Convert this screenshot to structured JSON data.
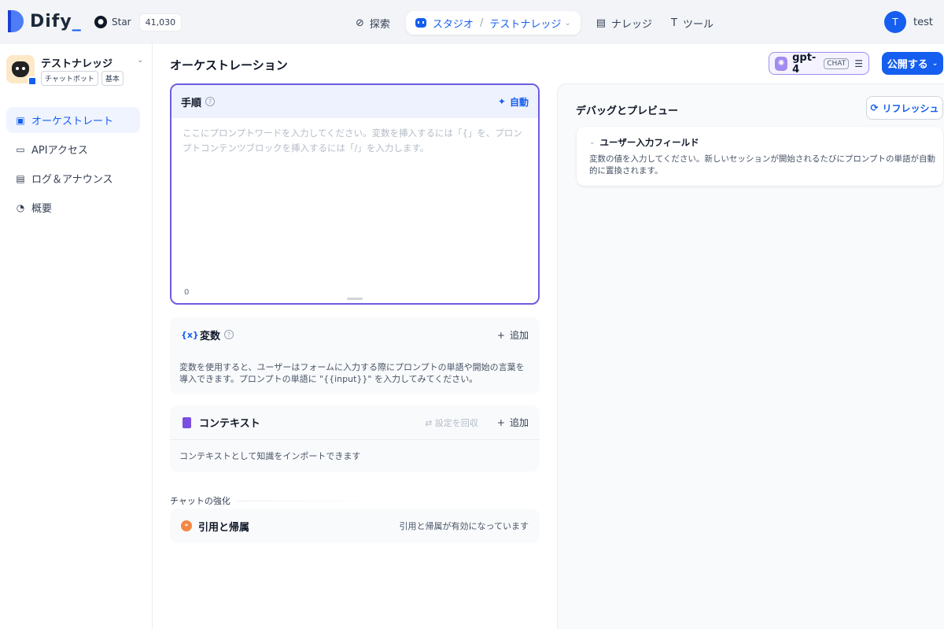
{
  "topbar": {
    "brand": "Dify",
    "brand_underscore": "_",
    "github_star": "Star",
    "github_count": "41,030",
    "nav": {
      "explore": "探索",
      "studio": "スタジオ",
      "studio_sep": "/",
      "studio_app": "テストナレッジ",
      "knowledge": "ナレッジ",
      "tools": "ツール"
    },
    "user": {
      "initial": "T",
      "name": "test"
    }
  },
  "sidebar": {
    "app_name": "テストナレッジ",
    "tags": [
      "チャットボット",
      "基本"
    ],
    "items": [
      {
        "label": "オーケストレート",
        "icon": "layout-icon",
        "active": true
      },
      {
        "label": "APIアクセス",
        "icon": "terminal-icon",
        "active": false
      },
      {
        "label": "ログ＆アナウンス",
        "icon": "file-list-icon",
        "active": false
      },
      {
        "label": "概要",
        "icon": "dashboard-icon",
        "active": false
      }
    ]
  },
  "main": {
    "title": "オーケストレーション",
    "model": {
      "name": "gpt-4",
      "mode": "CHAT"
    },
    "publish_label": "公開する",
    "prompt": {
      "title": "手順",
      "auto_label": "自動",
      "placeholder": "ここにプロンプトワードを入力してください。変数を挿入するには「{」を、プロンプトコンテンツブロックを挿入するには「/」を入力します。",
      "char_count": "0"
    },
    "variables": {
      "icon_text": "{x}",
      "title": "変数",
      "add_label": "追加",
      "description": "変数を使用すると、ユーザーはフォームに入力する際にプロンプトの単語や開始の言葉を導入できます。プロンプトの単語に \"{{input}}\" を入力してみてください。"
    },
    "context": {
      "title": "コンテキスト",
      "recall_label": "設定を回収",
      "add_label": "追加",
      "description": "コンテキストとして知識をインポートできます"
    },
    "enhance": {
      "section_title": "チャットの強化",
      "citation_title": "引用と帰属",
      "citation_status": "引用と帰属が有効になっています"
    }
  },
  "debug": {
    "title": "デバッグとプレビュー",
    "refresh_label": "リフレッシュ",
    "input_field": {
      "title": "ユーザー入力フィールド",
      "description": "変数の値を入力してください。新しいセッションが開始されるたびにプロンプトの単語が自動的に置換されます。"
    }
  },
  "colors": {
    "accent": "#155eef",
    "prompt_border": "#6d5ce0"
  }
}
